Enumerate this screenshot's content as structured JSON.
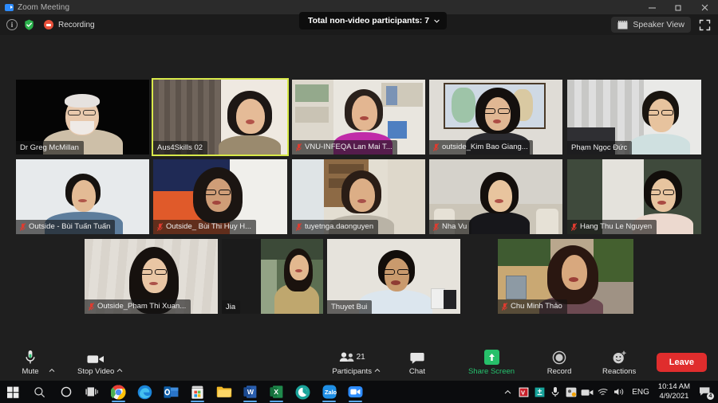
{
  "window": {
    "title": "Zoom Meeting",
    "app_icon": "zoom-logo-icon",
    "minimize_label": "Minimize",
    "restore_label": "Restore",
    "close_label": "Close"
  },
  "header": {
    "info_icon": "info-icon",
    "encryption_icon": "shield-check-icon",
    "recording_icon": "recording-indicator-icon",
    "recording_label": "Recording",
    "non_video_label": "Total non-video participants: 7",
    "non_video_count": "7",
    "view_label": "Speaker View",
    "view_icon": "speaker-view-icon",
    "fullscreen_icon": "enter-fullscreen-icon"
  },
  "grid": {
    "rows": [
      {
        "tiles": [
          {
            "name": "Dr Greg McMillan",
            "muted": false,
            "active": false
          },
          {
            "name": "Aus4Skills 02",
            "muted": false,
            "active": true
          },
          {
            "name": "VNU-INFEQA Lan Mai T...",
            "muted": true,
            "active": false
          },
          {
            "name": "outside_Kim Bao Giang...",
            "muted": true,
            "active": false
          },
          {
            "name": "Phạm Ngọc Đức",
            "muted": false,
            "active": false
          }
        ]
      },
      {
        "tiles": [
          {
            "name": "Outside - Bùi Tuấn Tuấn",
            "muted": true,
            "active": false
          },
          {
            "name": "Outside_ Bùi Thi Huy H...",
            "muted": true,
            "active": false
          },
          {
            "name": "tuyetnga.daonguyen",
            "muted": true,
            "active": false
          },
          {
            "name": "Nha Vu",
            "muted": true,
            "active": false
          },
          {
            "name": "Hang Thu Le Nguyen",
            "muted": true,
            "active": false
          }
        ]
      },
      {
        "tiles": [
          {
            "name": "Outside_Pham Thi Xuan...",
            "muted": true,
            "active": false
          },
          {
            "name": "Jia",
            "muted": false,
            "active": false
          },
          {
            "name": "Thuyet Bui",
            "muted": false,
            "active": false
          },
          {
            "name": "Chu Minh Thảo",
            "muted": true,
            "active": false
          }
        ]
      }
    ]
  },
  "toolbar": {
    "mute_label": "Mute",
    "mute_icon": "microphone-icon",
    "mute_caret_icon": "chevron-up-icon",
    "video_label": "Stop Video",
    "video_icon": "video-camera-icon",
    "video_caret_icon": "chevron-up-icon",
    "participants_label": "Participants",
    "participants_icon": "participants-icon",
    "participants_count": "21",
    "participants_caret_icon": "chevron-up-icon",
    "chat_label": "Chat",
    "chat_icon": "chat-bubble-icon",
    "share_label": "Share Screen",
    "share_icon": "share-screen-up-arrow-icon",
    "record_label": "Record",
    "record_icon": "record-circle-icon",
    "reactions_label": "Reactions",
    "reactions_icon": "reactions-smiley-icon",
    "leave_label": "Leave"
  },
  "taskbar": {
    "items": [
      {
        "icon": "windows-start-icon",
        "running": false
      },
      {
        "icon": "search-icon",
        "running": false
      },
      {
        "icon": "cortana-icon",
        "running": false
      },
      {
        "icon": "task-view-icon",
        "running": false
      },
      {
        "icon": "google-chrome-icon",
        "running": true
      },
      {
        "icon": "microsoft-edge-icon",
        "running": false
      },
      {
        "icon": "outlook-icon",
        "running": false
      },
      {
        "icon": "microsoft-store-icon",
        "running": true
      },
      {
        "icon": "file-explorer-icon",
        "running": false
      },
      {
        "icon": "microsoft-word-icon",
        "running": true
      },
      {
        "icon": "microsoft-excel-icon",
        "running": true
      },
      {
        "icon": "teal-circle-app-icon",
        "running": false
      },
      {
        "icon": "zalo-icon",
        "running": true
      },
      {
        "icon": "zoom-app-icon",
        "running": true
      }
    ],
    "tray": {
      "overflow_icon": "chevron-up-icon",
      "icons": [
        "v-app-icon",
        "teal-tray-icon",
        "microphone-tray-icon",
        "app-tray-icon",
        "camera-tray-icon",
        "network-icon",
        "volume-icon"
      ],
      "language": "ENG",
      "time": "10:14 AM",
      "date": "4/9/2021",
      "notification_icon": "notification-icon",
      "notification_count": "4"
    }
  },
  "colors": {
    "accent_blue": "#2d8cff",
    "active_speaker": "#d8e94a",
    "leave_red": "#e02d2d",
    "share_green": "#27c06a",
    "recording_red": "#e8503a"
  }
}
